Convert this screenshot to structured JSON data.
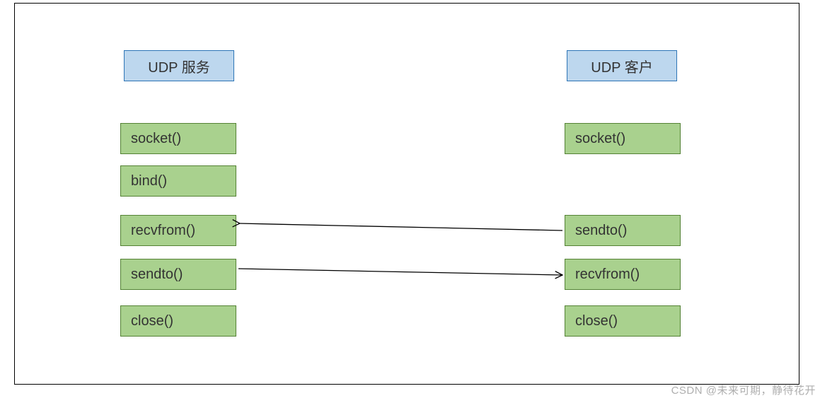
{
  "header": {
    "server_label": "UDP 服务",
    "client_label": "UDP 客户"
  },
  "server_steps": {
    "socket": "socket()",
    "bind": "bind()",
    "recvfrom": "recvfrom()",
    "sendto": "sendto()",
    "close": "close()"
  },
  "client_steps": {
    "socket": "socket()",
    "sendto": "sendto()",
    "recvfrom": "recvfrom()",
    "close": "close()"
  },
  "watermark": "CSDN @未来可期，静待花开",
  "colors": {
    "blue_fill": "#bdd7ee",
    "blue_border": "#2e75b6",
    "green_fill": "#a9d18e",
    "green_border": "#548235"
  },
  "chart_data": {
    "type": "diagram",
    "title": "UDP socket call flow",
    "nodes": [
      {
        "id": "srv-header",
        "label": "UDP 服务",
        "group": "server",
        "kind": "header"
      },
      {
        "id": "cli-header",
        "label": "UDP 客户",
        "group": "client",
        "kind": "header"
      },
      {
        "id": "srv-socket",
        "label": "socket()",
        "group": "server"
      },
      {
        "id": "srv-bind",
        "label": "bind()",
        "group": "server"
      },
      {
        "id": "srv-recvfrom",
        "label": "recvfrom()",
        "group": "server"
      },
      {
        "id": "srv-sendto",
        "label": "sendto()",
        "group": "server"
      },
      {
        "id": "srv-close",
        "label": "close()",
        "group": "server"
      },
      {
        "id": "cli-socket",
        "label": "socket()",
        "group": "client"
      },
      {
        "id": "cli-sendto",
        "label": "sendto()",
        "group": "client"
      },
      {
        "id": "cli-recvfrom",
        "label": "recvfrom()",
        "group": "client"
      },
      {
        "id": "cli-close",
        "label": "close()",
        "group": "client"
      }
    ],
    "edges": [
      {
        "from": "cli-sendto",
        "to": "srv-recvfrom",
        "direction": "left"
      },
      {
        "from": "srv-sendto",
        "to": "cli-recvfrom",
        "direction": "right"
      }
    ]
  }
}
